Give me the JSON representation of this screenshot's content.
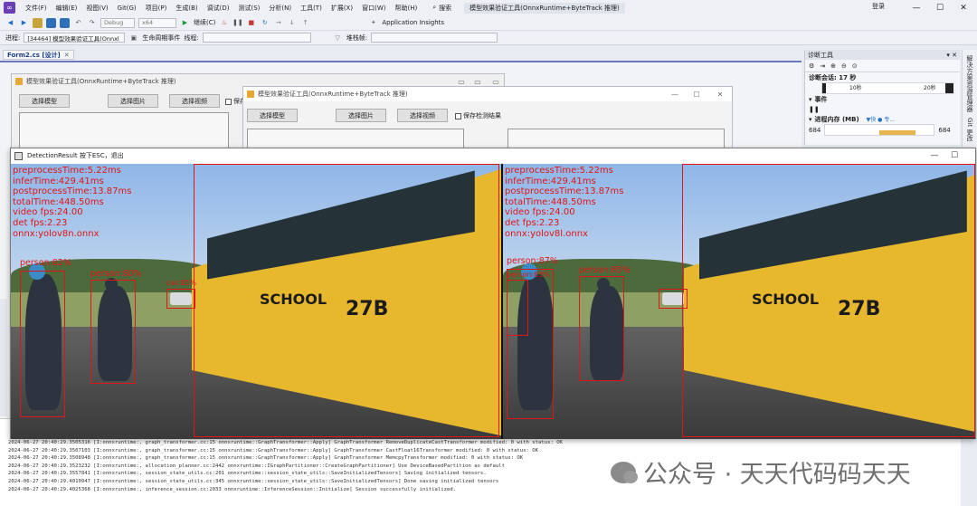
{
  "menubar": {
    "items": [
      "文件(F)",
      "编辑(E)",
      "视图(V)",
      "Git(G)",
      "项目(P)",
      "生成(B)",
      "调试(D)",
      "测试(S)",
      "分析(N)",
      "工具(T)",
      "扩展(X)",
      "窗口(W)",
      "帮助(H)"
    ],
    "search_label": "搜索",
    "window_title": "模型效果验证工具(OnnxRuntime+ByteTrack 推理)",
    "login": "登录"
  },
  "toolbar": {
    "config": "Debug",
    "platform": "x64",
    "continue": "继续(C)",
    "app_insights": "Application Insights"
  },
  "toolbar2": {
    "process_label": "进程:",
    "process_value": "[34464] 模型效果验证工具(Onnxl",
    "lifecycle_label": "生命周期事件",
    "thread_label": "线程:",
    "stackframe_label": "堆栈帧:"
  },
  "doc_tab": {
    "label": "Form2.cs [设计]"
  },
  "designer": {
    "form_back": {
      "title": "模型效果验证工具(OnnxRuntime+ByteTrack 推理)",
      "btn_model": "选择模型",
      "btn_image": "选择图片",
      "btn_video": "选择视频",
      "check_save": "保存"
    },
    "form_front": {
      "title": "模型效果验证工具(OnnxRuntime+ByteTrack 推理)",
      "btn_model": "选择模型",
      "btn_image": "选择图片",
      "btn_video": "选择视频",
      "check_save": "保存检测结果"
    }
  },
  "diagnostics": {
    "title": "诊断工具",
    "session": "诊断会话: 17 秒",
    "tick1": "10秒",
    "tick2": "20秒",
    "events_label": "事件",
    "memory_label": "进程内存 (MB)",
    "memory_legend": "▼快 ● 专...",
    "mem_left": "684",
    "mem_right": "684"
  },
  "side_tabs": [
    "解决方案资源管理器",
    "Git 更改"
  ],
  "detection_window": {
    "title": "DetectionResult 按下ESC，退出",
    "frames": [
      {
        "info_lines": [
          "preprocessTime:5.22ms",
          "inferTime:429.41ms",
          "postprocessTime:13.87ms",
          "totalTime:448.50ms",
          "video fps:24.00",
          "det fps:2.23",
          "onnx:yolov8n.onnx"
        ],
        "labels": [
          "person:82%",
          "person:80%",
          "car:85%"
        ]
      },
      {
        "info_lines": [
          "preprocessTime:5.22ms",
          "inferTime:429.41ms",
          "postprocessTime:13.87ms",
          "totalTime:448.50ms",
          "video fps:24.00",
          "det fps:2.23",
          "onnx:yolov8l.onnx"
        ],
        "labels": [
          "person:87%",
          "person:85%",
          "person:83%"
        ]
      }
    ],
    "bus_text": {
      "school": "SCHOOL",
      "number": "27B"
    }
  },
  "output": {
    "lines": [
      "2024-06-27 20:40:29.3505316 [I:onnxruntime:, graph_transformer.cc:15 onnxruntime::GraphTransformer::Apply] GraphTransformer RemoveDuplicateCastTransformer modified: 0 with status: OK",
      "2024-06-27 20:40:29.3507103 [I:onnxruntime:, graph_transformer.cc:15 onnxruntime::GraphTransformer::Apply] GraphTransformer CastFloat16Transformer modified: 0 with status: OK",
      "2024-06-27 20:40:29.3508948 [I:onnxruntime:, graph_transformer.cc:15 onnxruntime::GraphTransformer::Apply] GraphTransformer MemcpyTransformer modified: 0 with status: OK",
      "2024-06-27 20:40:29.3523232 [I:onnxruntime:, allocation_planner.cc:2442 onnxruntime::IGraphPartitioner::CreateGraphPartitioner] Use DeviceBasedPartition as default",
      "2024-06-27 20:40:29.3557841 [I:onnxruntime:, session_state_utils.cc:201 onnxruntime::session_state_utils::SaveInitializedTensors] Saving initialized tensors.",
      "2024-06-27 20:40:29.4010947 [I:onnxruntime:, session_state_utils.cc:345 onnxruntime::session_state_utils::SaveInitializedTensors] Done saving initialized tensors",
      "2024-06-27 20:40:29.4025368 [I:onnxruntime:, inference_session.cc:2033 onnxruntime::InferenceSession::Initialize] Session successfully initialized."
    ]
  },
  "watermark": {
    "text": "公众号 · 天天代码码天天"
  }
}
